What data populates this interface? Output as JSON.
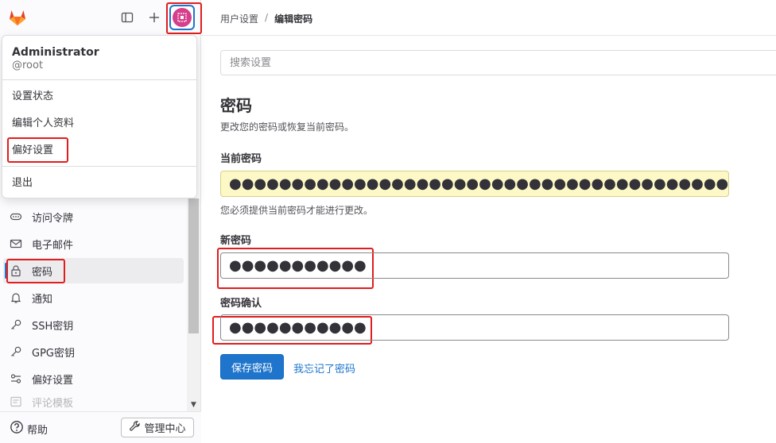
{
  "colors": {
    "accent": "#1f75cb",
    "highlight_box": "#e11d1d",
    "autofill": "#fdf9c6"
  },
  "topbar": {
    "logo_icon": "gitlab-logo",
    "sidebar_toggle_icon": "sidebar-panel-icon",
    "new_icon": "plus-icon",
    "avatar_icon": "user-avatar"
  },
  "dropdown": {
    "name": "Administrator",
    "username": "@root",
    "items": [
      "设置状态",
      "编辑个人资料",
      "偏好设置"
    ],
    "signout": "退出"
  },
  "nav": {
    "items": [
      {
        "label": "访问令牌",
        "icon": "token-icon"
      },
      {
        "label": "电子邮件",
        "icon": "mail-icon"
      },
      {
        "label": "密码",
        "icon": "lock-icon",
        "active": true
      },
      {
        "label": "通知",
        "icon": "bell-icon"
      },
      {
        "label": "SSH密钥",
        "icon": "key-icon"
      },
      {
        "label": "GPG密钥",
        "icon": "key-icon"
      },
      {
        "label": "偏好设置",
        "icon": "preferences-icon"
      },
      {
        "label": "评论模板",
        "icon": "comment-template-icon"
      }
    ]
  },
  "bottom": {
    "help": "帮助",
    "admin": "管理中心"
  },
  "breadcrumb": {
    "parent": "用户设置",
    "separator": "/",
    "current": "编辑密码"
  },
  "search": {
    "placeholder": "搜索设置"
  },
  "page": {
    "title": "密码",
    "description": "更改您的密码或恢复当前密码。"
  },
  "form": {
    "current_label": "当前密码",
    "current_value": "●●●●●●●●●●●●●●●●●●●●●●●●●●●●●●●●●●●●●●●●●●●●●●●●",
    "current_help": "您必须提供当前密码才能进行更改。",
    "new_label": "新密码",
    "new_value": "●●●●●●●●●●●",
    "confirm_label": "密码确认",
    "confirm_value": "●●●●●●●●●●●",
    "save": "保存密码",
    "forgot": "我忘记了密码"
  }
}
